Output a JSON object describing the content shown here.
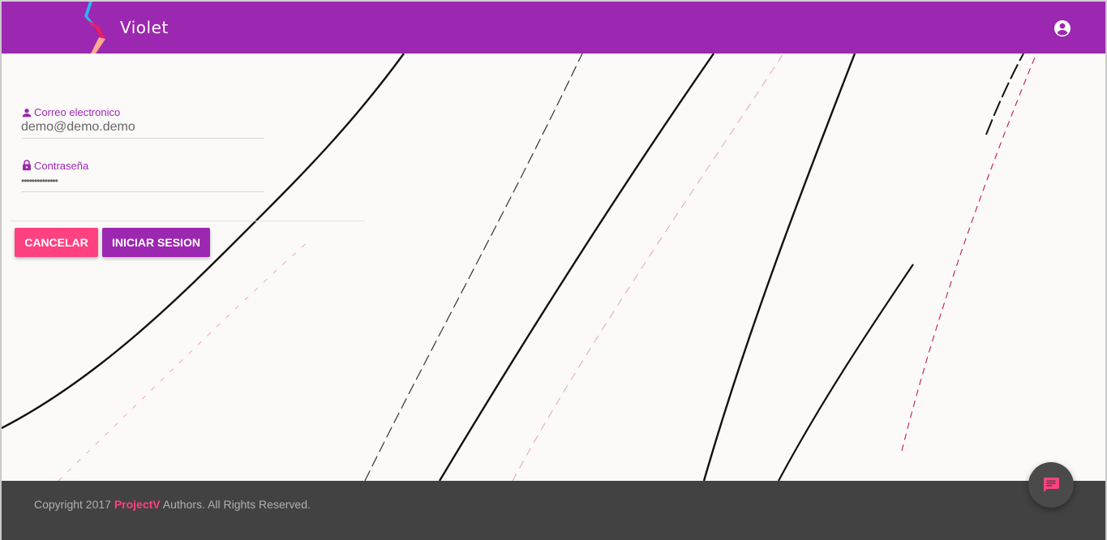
{
  "header": {
    "title": "Violet",
    "logo_icon": "violet-logo-icon",
    "account_icon": "account-circle-icon",
    "bar_color": "#9c27b0"
  },
  "login_form": {
    "email": {
      "label": "Correo electronico",
      "value": "demo@demo.demo",
      "icon": "person-icon"
    },
    "password": {
      "label": "Contraseña",
      "value": "••••••••••••••",
      "icon": "lock-icon"
    },
    "cancel_label": "CANCELAR",
    "login_label": "INICIAR SESION"
  },
  "footer": {
    "prefix": "Copyright 2017",
    "brand": "ProjectV",
    "suffix": "Authors. All Rights Reserved."
  },
  "fab": {
    "icon": "chat-icon"
  },
  "colors": {
    "primary": "#9c27b0",
    "accent": "#ff4081",
    "footer_bg": "#424242"
  }
}
